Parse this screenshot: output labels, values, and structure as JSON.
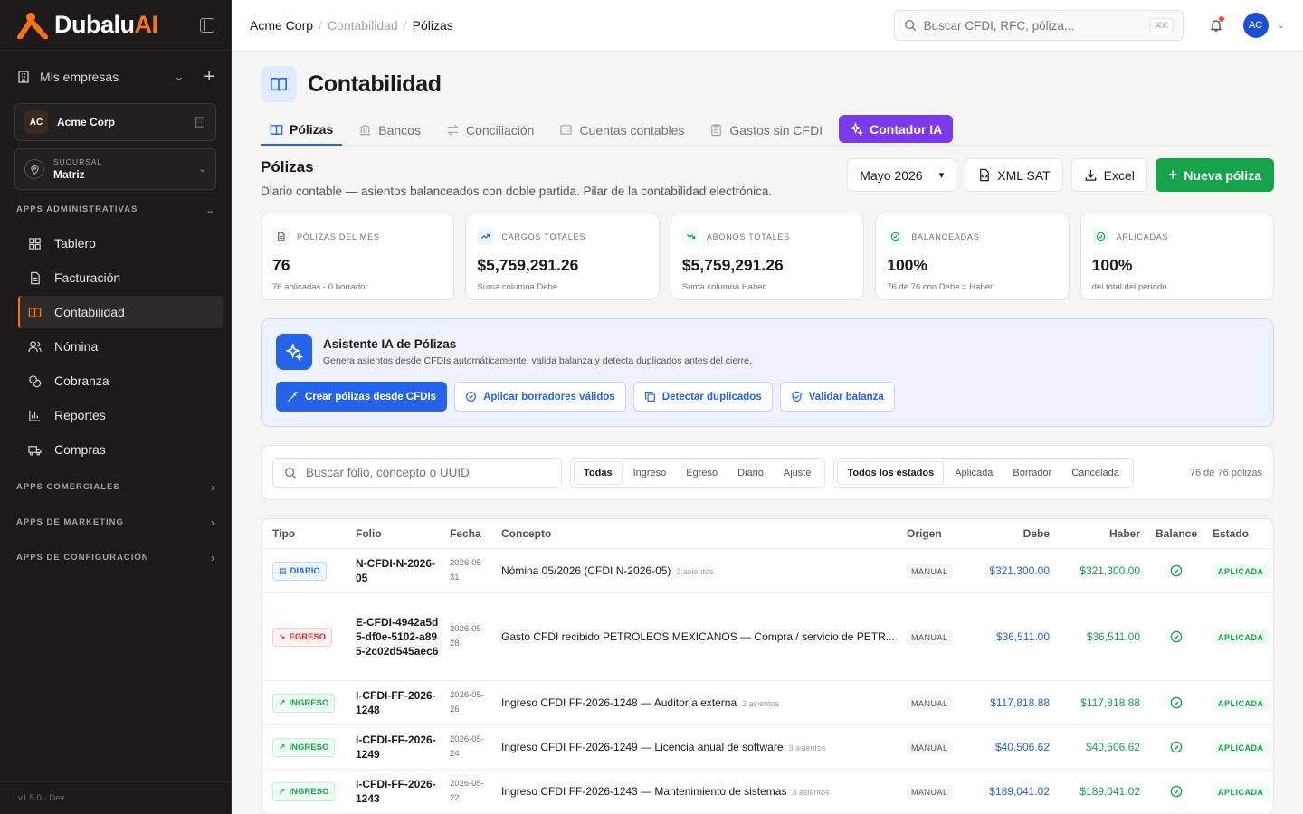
{
  "sidebar": {
    "brand_prefix": "Dubalu",
    "brand_suffix": "AI",
    "mis_empresas": "Mis empresas",
    "company": {
      "initials": "AC",
      "name": "Acme Corp"
    },
    "branch": {
      "caption": "SUCURSAL",
      "value": "Matriz"
    },
    "sections": {
      "admin": "APPS ADMINISTRATIVAS",
      "comerciales": "APPS COMERCIALES",
      "marketing": "APPS DE MARKETING",
      "config": "APPS DE CONFIGURACIÓN"
    },
    "items": [
      {
        "label": "Tablero",
        "icon": "grid-icon"
      },
      {
        "label": "Facturación",
        "icon": "document-icon"
      },
      {
        "label": "Contabilidad",
        "icon": "book-icon"
      },
      {
        "label": "Nómina",
        "icon": "users-icon"
      },
      {
        "label": "Cobranza",
        "icon": "coins-icon"
      },
      {
        "label": "Reportes",
        "icon": "bar-chart-icon"
      },
      {
        "label": "Compras",
        "icon": "truck-icon"
      }
    ],
    "version": "v1.5.0 · Dev"
  },
  "topbar": {
    "breadcrumb": [
      "Acme Corp",
      "Contabilidad",
      "Pólizas"
    ],
    "search_placeholder": "Buscar CFDI, RFC, póliza...",
    "shortcut": "⌘K",
    "avatar": "AC"
  },
  "page": {
    "title": "Contabilidad",
    "tabs": [
      "Pólizas",
      "Bancos",
      "Conciliación",
      "Cuentas contables",
      "Gastos sin CFDI",
      "Contador IA"
    ],
    "section_title": "Pólizas",
    "section_desc": "Diario contable — asientos balanceados con doble partida. Pilar de la contabilidad electrónica.",
    "period": "Mayo 2026",
    "btn_xml": "XML SAT",
    "btn_excel": "Excel",
    "btn_new": "Nueva póliza"
  },
  "stats": [
    {
      "label": "PÓLIZAS DEL MES",
      "value": "76",
      "sub": "76 aplicadas · 0 borrador"
    },
    {
      "label": "CARGOS TOTALES",
      "value": "$5,759,291.26",
      "sub": "Suma columna Debe"
    },
    {
      "label": "ABONOS TOTALES",
      "value": "$5,759,291.26",
      "sub": "Suma columna Haber"
    },
    {
      "label": "BALANCEADAS",
      "value": "100%",
      "sub": "76 de 76 con Debe = Haber"
    },
    {
      "label": "APLICADAS",
      "value": "100%",
      "sub": "del total del periodo"
    }
  ],
  "assistant": {
    "title": "Asistente IA de Pólizas",
    "desc": "Genera asientos desde CFDIs automáticamente, valida balanza y detecta duplicados antes del cierre.",
    "buttons": [
      "Crear pólizas desde CFDIs",
      "Aplicar borradores válidos",
      "Detectar duplicados",
      "Validar balanza"
    ]
  },
  "filters": {
    "search_placeholder": "Buscar folio, concepto o UUID",
    "types": [
      "Todas",
      "Ingreso",
      "Egreso",
      "Diario",
      "Ajuste"
    ],
    "states": [
      "Todos los estados",
      "Aplicada",
      "Borrador",
      "Cancelada"
    ],
    "count": "76 de 76 pólizas"
  },
  "table": {
    "headers": [
      "Tipo",
      "Folio",
      "Fecha",
      "Concepto",
      "Origen",
      "Debe",
      "Haber",
      "Balance",
      "Estado"
    ],
    "rows": [
      {
        "tipo": "DIARIO",
        "folio": "N-CFDI-N-2026-05",
        "fecha": "2026-05-31",
        "concepto": "Nómina 05/2026 (CFDI N-2026-05)",
        "asientos": "3 asientos",
        "origen": "MANUAL",
        "debe": "$321,300.00",
        "haber": "$321,300.00",
        "estado": "APLICADA"
      },
      {
        "tipo": "EGRESO",
        "folio": "E-CFDI-4942a5d5-df0e-5102-a895-2c02d545aec6",
        "fecha": "2026-05-28",
        "concepto": "Gasto CFDI recibido PETROLEOS MEXICANOS — Compra / servicio de PETR...",
        "asientos": "",
        "origen": "MANUAL",
        "debe": "$36,511.00",
        "haber": "$36,511.00",
        "estado": "APLICADA"
      },
      {
        "tipo": "INGRESO",
        "folio": "I-CFDI-FF-2026-1248",
        "fecha": "2026-05-26",
        "concepto": "Ingreso CFDI FF-2026-1248 — Auditoría externa",
        "asientos": "3 asientos",
        "origen": "MANUAL",
        "debe": "$117,818.88",
        "haber": "$117,818.88",
        "estado": "APLICADA"
      },
      {
        "tipo": "INGRESO",
        "folio": "I-CFDI-FF-2026-1249",
        "fecha": "2026-05-24",
        "concepto": "Ingreso CFDI FF-2026-1249 — Licencia anual de software",
        "asientos": "3 asientos",
        "origen": "MANUAL",
        "debe": "$40,506.62",
        "haber": "$40,506.62",
        "estado": "APLICADA"
      },
      {
        "tipo": "INGRESO",
        "folio": "I-CFDI-FF-2026-1243",
        "fecha": "2026-05-22",
        "concepto": "Ingreso CFDI FF-2026-1243 — Mantenimiento de sistemas",
        "asientos": "3 asientos",
        "origen": "MANUAL",
        "debe": "$189,041.02",
        "haber": "$189,041.02",
        "estado": "APLICADA"
      }
    ]
  },
  "colors": {
    "brand": "#f97316",
    "primary": "#2563eb",
    "success": "#16a34a",
    "ia": "#7c3aed",
    "danger": "#dc2626"
  }
}
